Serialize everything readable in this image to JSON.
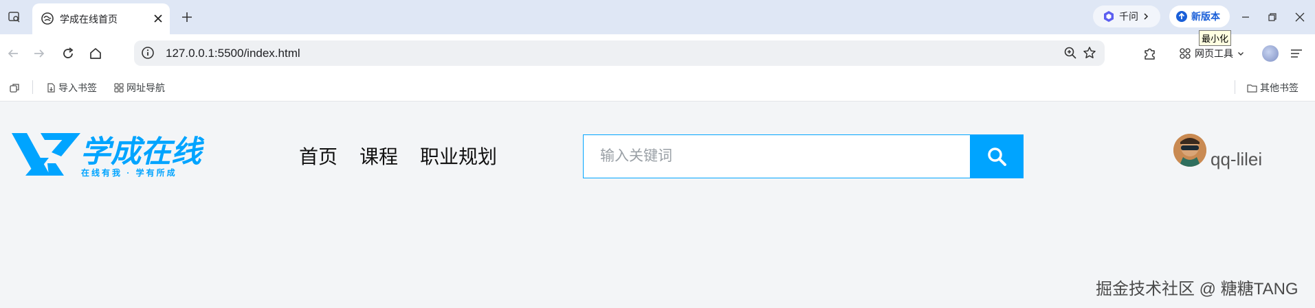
{
  "browser": {
    "tab": {
      "title": "学成在线首页"
    },
    "qianwen_label": "千问",
    "new_version_label": "新版本",
    "tooltip": "最小化",
    "url": "127.0.0.1:5500/index.html",
    "tools_label": "网页工具",
    "bookmarks": {
      "import_label": "导入书签",
      "nav_label": "网址导航",
      "other_label": "其他书签"
    }
  },
  "site": {
    "logo": {
      "title": "学成在线",
      "slogan": "在线有我 · 学有所成"
    },
    "nav": [
      "首页",
      "课程",
      "职业规划"
    ],
    "search": {
      "placeholder": "输入关键词"
    },
    "user": {
      "name": "qq-lilei"
    },
    "accent_color": "#00a4ff"
  },
  "watermark": "掘金技术社区 @ 糖糖TANG"
}
